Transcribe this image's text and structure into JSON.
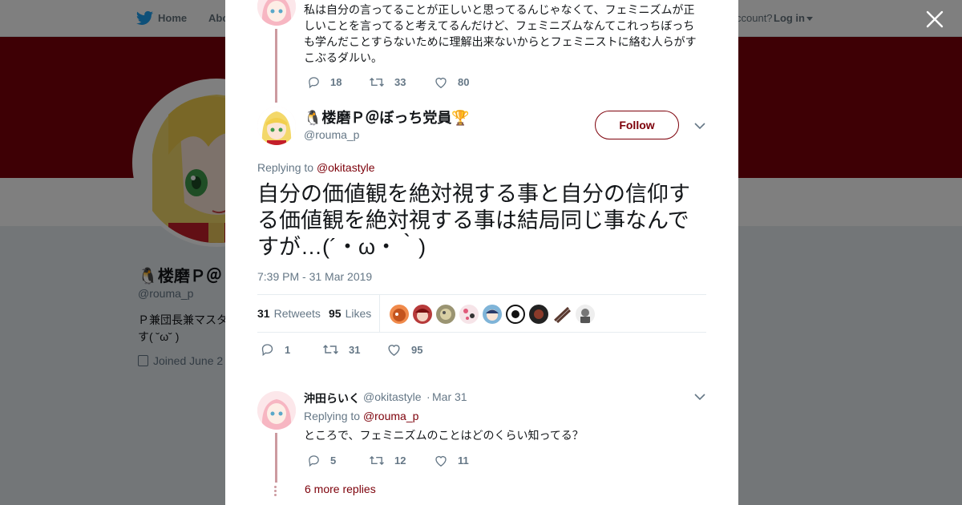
{
  "topbar": {
    "home_label": "Home",
    "about_label": "Abo",
    "account_question": "ccount?",
    "login_label": "Log in"
  },
  "profile": {
    "name": "🐧楼磨Ｐ＠",
    "handle": "@rouma_p",
    "bio_line1": "Ｐ兼団長兼マスタ",
    "bio_line2": "す( ˘ω˘ )",
    "joined": "Joined June 2"
  },
  "parent_tweet": {
    "text": "私は自分の言ってることが正しいと思ってるんじゃなくて、フェミニズムが正しいことを言ってると考えてるんだけど、フェミニズムなんてこれっちぼっちも学んだことすらないために理解出来ないからとフェミニストに絡む人らがすこぶるダルい。",
    "replies": "18",
    "retweets": "33",
    "likes": "80"
  },
  "main_tweet": {
    "name": "🐧楼磨Ｐ＠ぼっち党員🏆",
    "handle": "@rouma_p",
    "follow_label": "Follow",
    "replying_prefix": "Replying to",
    "replying_to": "@okitastyle",
    "text": "自分の価値観を絶対視する事と自分の信仰する価値観を絶対視する事は結局同じ事なんですが…(´・ω・｀)",
    "timestamp": "7:39 PM - 31 Mar 2019",
    "retweet_count": "31",
    "retweet_label": "Retweets",
    "like_count": "95",
    "like_label": "Likes",
    "replies": "1",
    "retweets": "31",
    "likes": "95"
  },
  "reply_tweet": {
    "name": "沖田らいく",
    "handle": "@okitastyle",
    "dot": "·",
    "date": "Mar 31",
    "replying_prefix": "Replying to",
    "replying_to": "@rouma_p",
    "text": "ところで、フェミニズムのことはどのくらい知ってる？",
    "replies": "5",
    "retweets": "12",
    "likes": "11",
    "more_replies": "6 more replies"
  },
  "colors": {
    "brand": "#7d000a",
    "thread_line": "#cc9aa0",
    "muted": "#657786",
    "twitter_blue": "#1da1f2"
  }
}
